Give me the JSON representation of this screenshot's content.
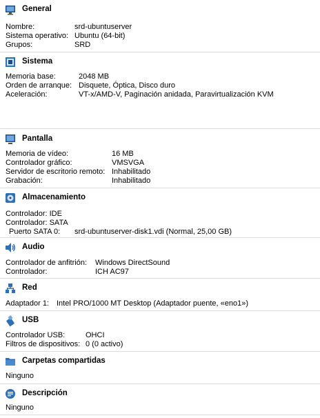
{
  "colors": {
    "icon_blue": "#2f6fb5",
    "icon_dark": "#1d4e89",
    "divider": "#dcdcdc"
  },
  "general": {
    "title": "General",
    "icon": "monitor-icon",
    "rows": [
      {
        "label": "Nombre:",
        "value": "srd-ubuntuserver"
      },
      {
        "label": "Sistema operativo:",
        "value": "Ubuntu (64-bit)"
      },
      {
        "label": "Grupos:",
        "value": "SRD"
      }
    ]
  },
  "sistema": {
    "title": "Sistema",
    "icon": "chip-icon",
    "rows": [
      {
        "label": "Memoria base:",
        "value": "2048 MB"
      },
      {
        "label": "Orden de arranque:",
        "value": "Disquete, Óptica, Disco duro"
      },
      {
        "label": "Aceleración:",
        "value": "VT-x/AMD-V, Paginación anidada, Paravirtualización KVM"
      }
    ]
  },
  "pantalla": {
    "title": "Pantalla",
    "icon": "display-icon",
    "rows": [
      {
        "label": "Memoria de vídeo:",
        "value": "16 MB"
      },
      {
        "label": "Controlador gráfico:",
        "value": "VMSVGA"
      },
      {
        "label": "Servidor de escritorio remoto:",
        "value": "Inhabilitado"
      },
      {
        "label": "Grabación:",
        "value": "Inhabilitado"
      }
    ]
  },
  "almacenamiento": {
    "title": "Almacenamiento",
    "icon": "storage-icon",
    "rows": [
      {
        "label": "Controlador: IDE",
        "value": ""
      },
      {
        "label": "Controlador: SATA",
        "value": ""
      },
      {
        "label": "Puerto SATA 0:",
        "value": "srd-ubuntuserver-disk1.vdi (Normal, 25,00 GB)"
      }
    ]
  },
  "audio": {
    "title": "Audio",
    "icon": "speaker-icon",
    "rows": [
      {
        "label": "Controlador de anfitrión:",
        "value": "Windows DirectSound"
      },
      {
        "label": "Controlador:",
        "value": "ICH AC97"
      }
    ]
  },
  "red": {
    "title": "Red",
    "icon": "network-icon",
    "rows": [
      {
        "label": "Adaptador 1:",
        "value": "Intel PRO/1000 MT Desktop (Adaptador puente, «eno1»)"
      }
    ]
  },
  "usb": {
    "title": "USB",
    "icon": "usb-icon",
    "rows": [
      {
        "label": "Controlador USB:",
        "value": "OHCI"
      },
      {
        "label": "Filtros de dispositivos:",
        "value": "0 (0 activo)"
      }
    ]
  },
  "carpetas": {
    "title": "Carpetas compartidas",
    "icon": "folder-icon",
    "rows": [
      {
        "label": "Ninguno",
        "value": ""
      }
    ]
  },
  "descripcion": {
    "title": "Descripción",
    "icon": "description-icon",
    "rows": [
      {
        "label": "Ninguno",
        "value": ""
      }
    ]
  }
}
